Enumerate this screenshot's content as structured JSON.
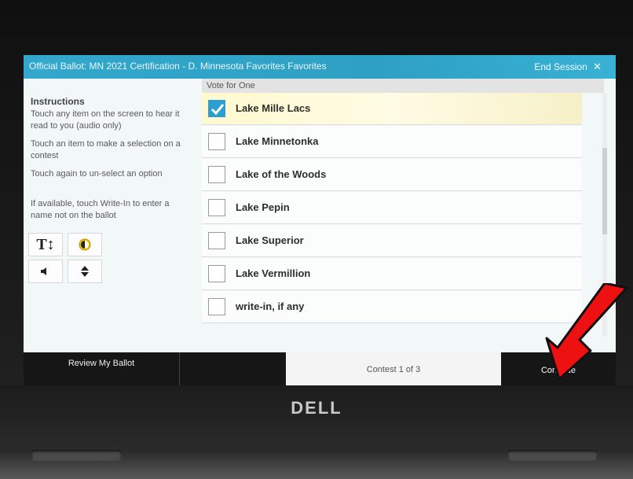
{
  "titlebar": {
    "title": "Official Ballot: MN 2021 Certification - D. Minnesota Favorites Favorites",
    "end_session_label": "End Session",
    "close_glyph": "✕"
  },
  "instructions": {
    "heading": "Instructions",
    "items": [
      "Touch any item on the screen to hear it read to you (audio only)",
      "Touch an item to make a selection on a contest",
      "Touch again to un-select an option",
      "If available, touch Write-In to enter a name not on the ballot"
    ]
  },
  "tools": {
    "text_size_label": "T↕",
    "icons": [
      "text-size-icon",
      "contrast-icon",
      "audio-speaker-icon",
      "navigate-up-down-icon"
    ]
  },
  "contest": {
    "vote_for": "Vote for One",
    "options": [
      {
        "label": "Lake Mille Lacs",
        "checked": true
      },
      {
        "label": "Lake Minnetonka",
        "checked": false
      },
      {
        "label": "Lake of the Woods",
        "checked": false
      },
      {
        "label": "Lake Pepin",
        "checked": false
      },
      {
        "label": "Lake Superior",
        "checked": false
      },
      {
        "label": "Lake Vermillion",
        "checked": false
      },
      {
        "label": "write-in, if any",
        "checked": false
      }
    ]
  },
  "footer": {
    "review_label": "Review My Ballot",
    "counter": "Contest 1 of 3",
    "continue_label": "Continue"
  },
  "device": {
    "logo": "DELL"
  },
  "colors": {
    "titlebar": "#33a8cc",
    "checkbox_checked": "#2b9fd2",
    "annotation_arrow": "#ee1111"
  }
}
